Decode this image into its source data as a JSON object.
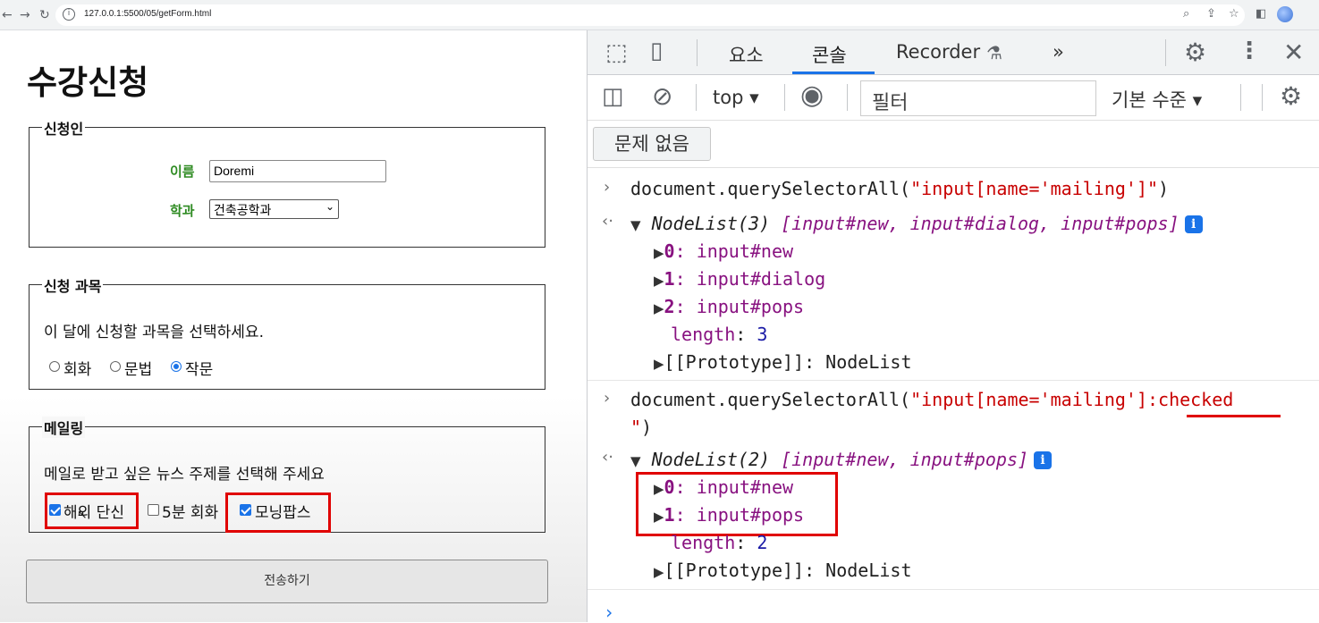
{
  "browser": {
    "url": "127.0.0.1:5500/05/getForm.html"
  },
  "page": {
    "title": "수강신청",
    "applicant": {
      "legend": "신청인",
      "name_label": "이름",
      "name_value": "Doremi",
      "dept_label": "학과",
      "dept_value": "건축공학과"
    },
    "course": {
      "legend": "신청 과목",
      "instruction": "이 달에 신청할 과목을 선택하세요.",
      "options": [
        "회화",
        "문법",
        "작문"
      ],
      "selected": "작문"
    },
    "mailing": {
      "legend": "메일링",
      "instruction": "메일로 받고 싶은 뉴스 주제를 선택해 주세요",
      "options": [
        {
          "label": "해외 단신",
          "checked": true
        },
        {
          "label": "5분 회화",
          "checked": false
        },
        {
          "label": "모닝팝스",
          "checked": true
        }
      ]
    },
    "submit_label": "전송하기"
  },
  "devtools": {
    "tabs": {
      "elements": "요소",
      "console": "콘솔",
      "recorder": "Recorder",
      "more": "»"
    },
    "toolbar": {
      "context": "top",
      "filter_placeholder": "필터",
      "level": "기본 수준"
    },
    "issues": "문제 없음",
    "console": {
      "cmd1": {
        "prefix": "document.querySelectorAll(",
        "arg": "\"input[name='mailing']\"",
        "suffix": ")"
      },
      "result1": {
        "head": "NodeList(3) ",
        "list": "[input#new, input#dialog, input#pops]",
        "items": [
          {
            "key": "0",
            "value": "input#new"
          },
          {
            "key": "1",
            "value": "input#dialog"
          },
          {
            "key": "2",
            "value": "input#pops"
          }
        ],
        "length_key": "length",
        "length_value": "3",
        "proto": "[[Prototype]]: NodeList"
      },
      "cmd2": {
        "prefix": "document.querySelectorAll(",
        "arg_line1": "\"input[name='mailing']:checked",
        "arg_line2": "\"",
        "suffix": ")"
      },
      "result2": {
        "head": "NodeList(2) ",
        "list": "[input#new, input#pops]",
        "items": [
          {
            "key": "0",
            "value": "input#new"
          },
          {
            "key": "1",
            "value": "input#pops"
          }
        ],
        "length_key": "length",
        "length_value": "2",
        "proto": "[[Prototype]]: NodeList"
      }
    }
  },
  "colors": {
    "accent": "#1a73e8",
    "highlight": "#e00000",
    "label_green": "#2e8b22"
  }
}
